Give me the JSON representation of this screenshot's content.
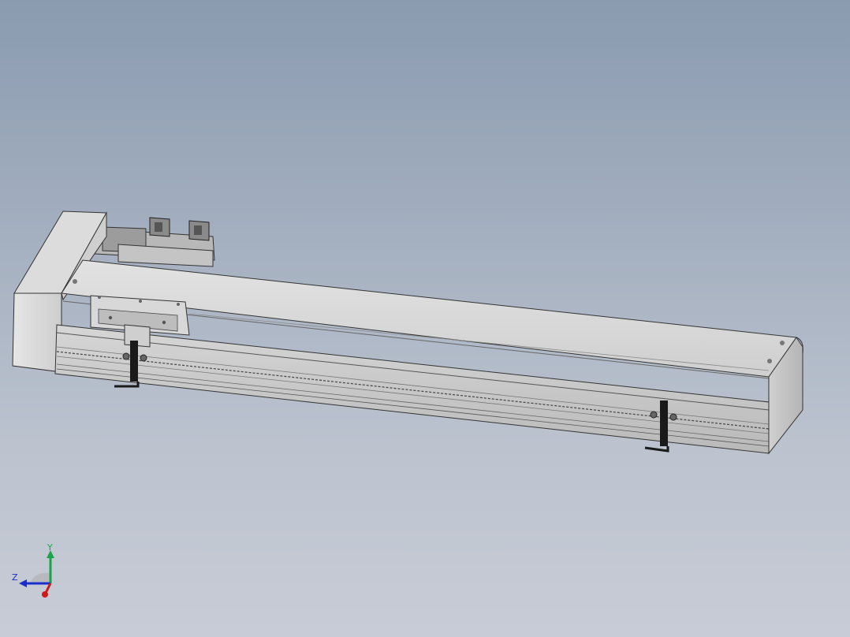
{
  "viewport": {
    "background_top": "#8a9bb0",
    "background_bottom": "#c8ccd6"
  },
  "model": {
    "body_color": "#d9d9d9",
    "edge_color": "#3a3a3a",
    "handle_color": "#1a1a1a"
  },
  "triad": {
    "x_label": "",
    "y_label": "Y",
    "z_label": "Z",
    "x_color": "#cc1a1a",
    "y_color": "#1aa34a",
    "z_color": "#1a2ecc"
  }
}
